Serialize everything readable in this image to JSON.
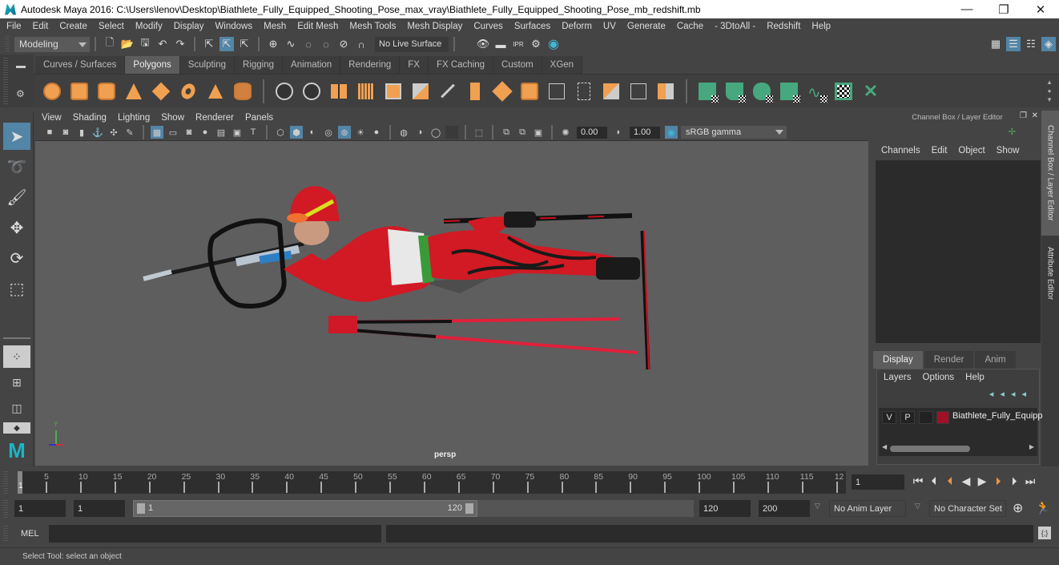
{
  "window": {
    "title": "Autodesk Maya 2016: C:\\Users\\lenov\\Desktop\\Biathlete_Fully_Equipped_Shooting_Pose_max_vray\\Biathlete_Fully_Equipped_Shooting_Pose_mb_redshift.mb",
    "minimize": "—",
    "maximize": "❐",
    "close": "✕"
  },
  "menubar": [
    "File",
    "Edit",
    "Create",
    "Select",
    "Modify",
    "Display",
    "Windows",
    "Mesh",
    "Edit Mesh",
    "Mesh Tools",
    "Mesh Display",
    "Curves",
    "Surfaces",
    "Deform",
    "UV",
    "Generate",
    "Cache",
    "- 3DtoAll -",
    "Redshift",
    "Help"
  ],
  "statusline": {
    "menuset": "Modeling",
    "live_surface": "No Live Surface"
  },
  "shelf": {
    "tabs": [
      "Curves / Surfaces",
      "Polygons",
      "Sculpting",
      "Rigging",
      "Animation",
      "Rendering",
      "FX",
      "FX Caching",
      "Custom",
      "XGen"
    ],
    "active_tab": "Polygons",
    "orange_tools": [
      "poly-sphere",
      "poly-cube",
      "poly-cylinder",
      "poly-cone",
      "poly-plane",
      "poly-torus",
      "poly-pyramid",
      "poly-pipe"
    ],
    "edit_tools": [
      "combine",
      "separate",
      "mirror",
      "smooth",
      "reduce",
      "extract",
      "bevel",
      "bridge",
      "extrude",
      "multi-cut",
      "target-weld",
      "connect",
      "bridge-edges",
      "insert-edge-loop",
      "append",
      "merge",
      "fill-hole"
    ],
    "uv_tools": [
      "planar-uv",
      "cylindrical-uv",
      "spherical-uv",
      "automatic-uv",
      "unfold-uv",
      "uv-editor",
      "cut-sew-uv"
    ]
  },
  "panel": {
    "menu": [
      "View",
      "Shading",
      "Lighting",
      "Show",
      "Renderer",
      "Panels"
    ],
    "exposure": "0.00",
    "gamma": "1.00",
    "color_space": "sRGB gamma",
    "camera_label": "persp",
    "axis": {
      "x": "x",
      "y": "Y",
      "z": "z"
    }
  },
  "channelbox": {
    "title": "Channel Box / Layer Editor",
    "menu": [
      "Channels",
      "Edit",
      "Object",
      "Show"
    ]
  },
  "sidetabs": [
    "Channel Box / Layer Editor",
    "Attribute Editor"
  ],
  "layers": {
    "tabs": [
      "Display",
      "Render",
      "Anim"
    ],
    "active_tab": "Display",
    "menu": [
      "Layers",
      "Options",
      "Help"
    ],
    "rows": [
      {
        "v": "V",
        "p": "P",
        "color": "#a01028",
        "name": "Biathlete_Fully_Equipp"
      }
    ]
  },
  "timeslider": {
    "ticks": [
      "5",
      "10",
      "15",
      "20",
      "25",
      "30",
      "35",
      "40",
      "45",
      "50",
      "55",
      "60",
      "65",
      "70",
      "75",
      "80",
      "85",
      "90",
      "95",
      "100",
      "105",
      "110",
      "115",
      "12"
    ],
    "current_marker": "1",
    "current_frame": "1"
  },
  "range": {
    "start": "1",
    "playback_start": "1",
    "slider_start": "1",
    "slider_end": "120",
    "playback_end": "120",
    "end": "200",
    "anim_layer": "No Anim Layer",
    "character_set": "No Character Set"
  },
  "playback_buttons": [
    "go-to-start",
    "step-back-key",
    "step-back-frame",
    "play-backward",
    "play-forward",
    "step-forward-frame",
    "step-forward-key",
    "go-to-end"
  ],
  "command": {
    "label": "MEL"
  },
  "help_line": "Select Tool: select an object"
}
